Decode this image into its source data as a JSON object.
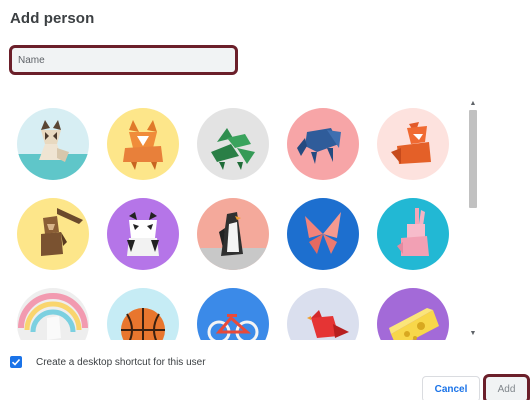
{
  "dialog": {
    "title": "Add person"
  },
  "name_input": {
    "placeholder": "Name",
    "value": ""
  },
  "avatars": [
    {
      "name": "cat",
      "bg": "#88c8d8"
    },
    {
      "name": "corgi",
      "bg": "#fde68a"
    },
    {
      "name": "dragon",
      "bg": "#dcdcdc"
    },
    {
      "name": "elephant",
      "bg": "#f7a5a7"
    },
    {
      "name": "fox",
      "bg": "#fde2de"
    },
    {
      "name": "monkey",
      "bg": "#fde68a"
    },
    {
      "name": "panda",
      "bg": "#b575e8"
    },
    {
      "name": "penguin",
      "bg": "#f4a99b"
    },
    {
      "name": "butterfly",
      "bg": "#1d6fcf"
    },
    {
      "name": "rabbit",
      "bg": "#22b8d4"
    },
    {
      "name": "unicorn",
      "bg": "#e6e6e6"
    },
    {
      "name": "basketball",
      "bg": "#c6ecf5"
    },
    {
      "name": "bike",
      "bg": "#3b8ae8"
    },
    {
      "name": "bird",
      "bg": "#dadfee"
    },
    {
      "name": "cheese",
      "bg": "#a36ad8"
    }
  ],
  "shortcut": {
    "label": "Create a desktop shortcut for this user",
    "checked": true
  },
  "buttons": {
    "cancel": "Cancel",
    "add": "Add"
  },
  "colors": {
    "accent": "#1a73e8",
    "highlight_border": "#6b1f2a"
  }
}
